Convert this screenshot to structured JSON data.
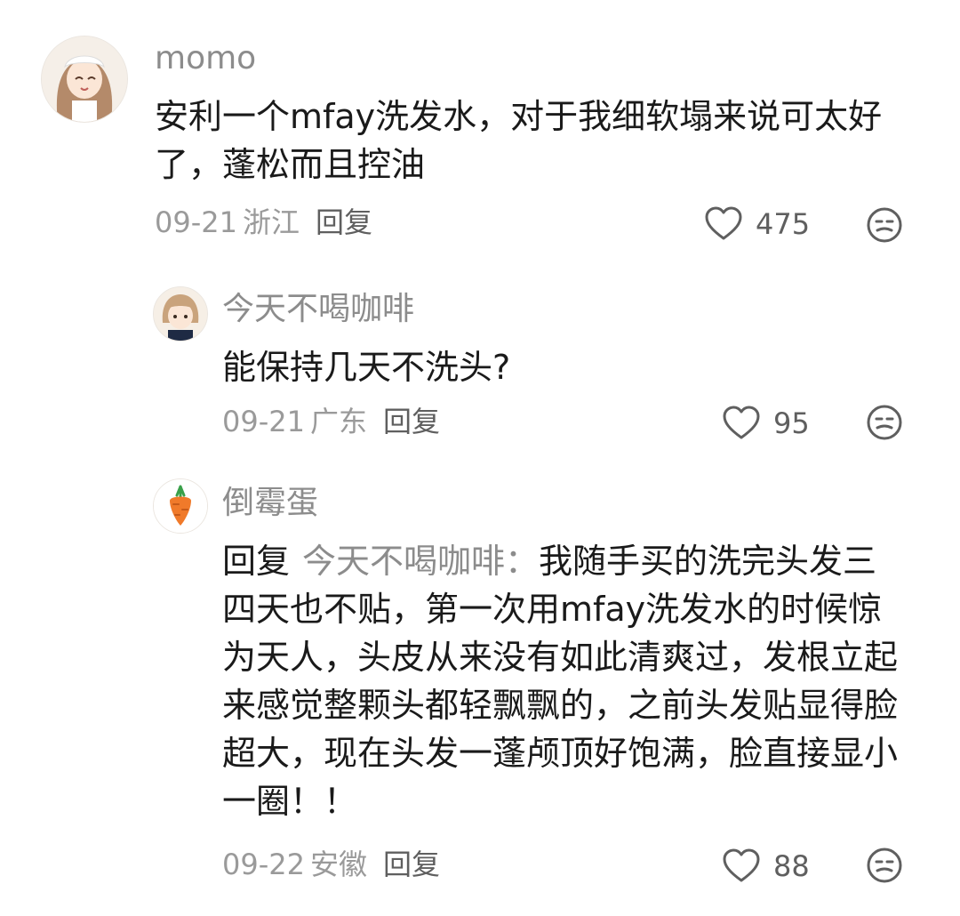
{
  "comments": [
    {
      "username": "momo",
      "text": "安利一个mfay洗发水，对于我细软塌来说可太好了，蓬松而且控油",
      "date": "09-21",
      "location": "浙江",
      "reply_label": "回复",
      "likes": "475",
      "avatar_icon": "anime-girl-avatar"
    },
    {
      "username": "今天不喝咖啡",
      "text": "能保持几天不洗头?",
      "date": "09-21",
      "location": "广东",
      "reply_label": "回复",
      "likes": "95",
      "avatar_icon": "anime-boy-avatar"
    },
    {
      "username": "倒霉蛋",
      "reply_prefix": "回复",
      "reply_target": "今天不喝咖啡：",
      "text": "我随手买的洗完头发三四天也不贴，第一次用mfay洗发水的时候惊为天人，头皮从来没有如此清爽过，发根立起来感觉整颗头都轻飘飘的，之前头发贴显得脸超大，现在头发一蓬颅顶好饱满，脸直接显小一圈！！",
      "date": "09-22",
      "location": "安徽",
      "reply_label": "回复",
      "likes": "88",
      "avatar_icon": "carrot-avatar"
    }
  ],
  "colors": {
    "username": "#8c8c8c",
    "text": "#1a1a1a",
    "meta": "#9a9a9a",
    "icon": "#5f5f5f"
  }
}
